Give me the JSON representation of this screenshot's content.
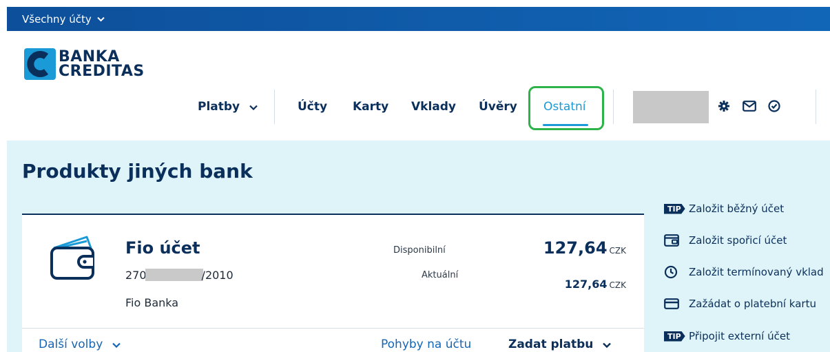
{
  "topbar": {
    "label": "Všechny účty",
    "chevron_icon": "chevron-down-icon"
  },
  "logo": {
    "line1": "BANKA",
    "line2": "CREDITAS"
  },
  "nav": {
    "items": [
      {
        "label": "Platby",
        "has_dropdown": true
      },
      {
        "label": "Účty"
      },
      {
        "label": "Karty"
      },
      {
        "label": "Vklady"
      },
      {
        "label": "Úvěry"
      },
      {
        "label": "Ostatní",
        "active": true
      }
    ],
    "icons": [
      "gear-icon",
      "mail-icon",
      "check-circle-icon"
    ]
  },
  "colors": {
    "primary": "#0b2f5b",
    "accent": "#1a9ad6",
    "highlight": "#2db34a",
    "content_bg": "#dff4f8"
  },
  "page": {
    "title": "Produkty jiných bank"
  },
  "account": {
    "name": "Fio účet",
    "number_prefix": "270",
    "number_suffix": "/2010",
    "bank": "Fio Banka",
    "available_label": "Disponibilní",
    "available_amount": "127,64",
    "current_label": "Aktuální",
    "current_amount": "127,64",
    "currency": "CZK",
    "footer": {
      "more_options": "Další volby",
      "transactions": "Pohyby na účtu",
      "new_payment": "Zadat platbu"
    }
  },
  "sidebar": {
    "tip_badge": "TIP",
    "items": [
      {
        "label": "Založit běžný účet",
        "icon": "tip-badge"
      },
      {
        "label": "Založit spořicí účet",
        "icon": "savings-icon"
      },
      {
        "label": "Založit termínovaný vklad",
        "icon": "clock-icon"
      },
      {
        "label": "Zažádat o platební kartu",
        "icon": "card-icon"
      },
      {
        "label": "Připojit externí účet",
        "icon": "tip-badge"
      }
    ]
  }
}
